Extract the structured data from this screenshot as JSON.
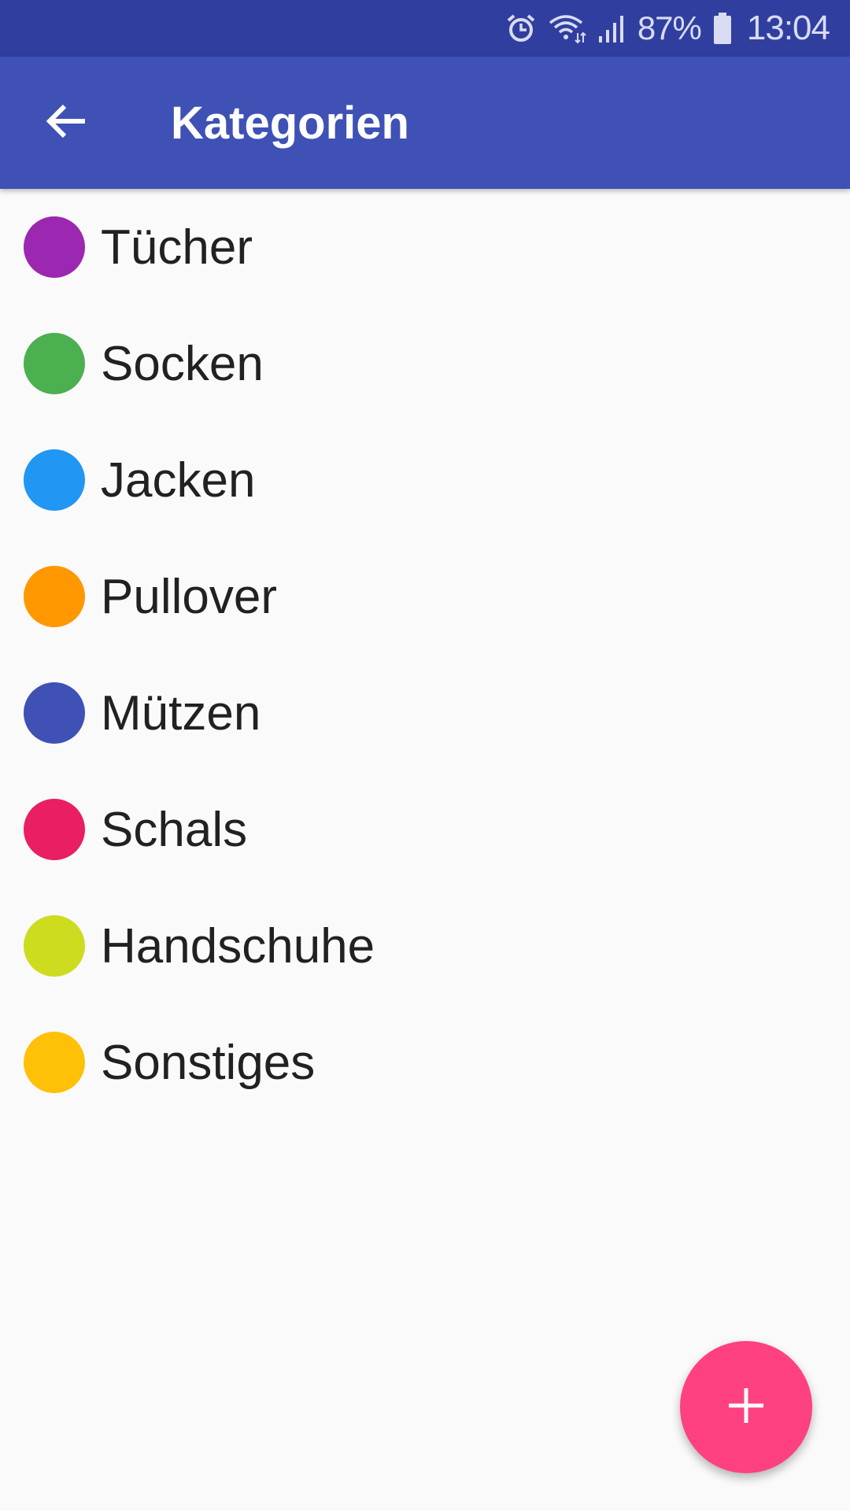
{
  "status_bar": {
    "battery_percent": "87%",
    "time": "13:04",
    "icons": [
      "alarm-icon",
      "wifi-icon",
      "signal-icon",
      "battery-icon"
    ]
  },
  "app_bar": {
    "title": "Kategorien",
    "back_icon": "arrow-back-icon"
  },
  "categories": [
    {
      "label": "Tücher",
      "color": "#9c27b0"
    },
    {
      "label": "Socken",
      "color": "#4caf50"
    },
    {
      "label": "Jacken",
      "color": "#2196f3"
    },
    {
      "label": "Pullover",
      "color": "#ff9800"
    },
    {
      "label": "Mützen",
      "color": "#3f51b5"
    },
    {
      "label": "Schals",
      "color": "#e91e63"
    },
    {
      "label": "Handschuhe",
      "color": "#cddc1f"
    },
    {
      "label": "Sonstiges",
      "color": "#ffc107"
    }
  ],
  "fab": {
    "icon": "add-icon",
    "color": "#ff4081"
  },
  "colors": {
    "status_bar": "#303f9f",
    "app_bar": "#3f51b5",
    "background": "#fafafa"
  }
}
